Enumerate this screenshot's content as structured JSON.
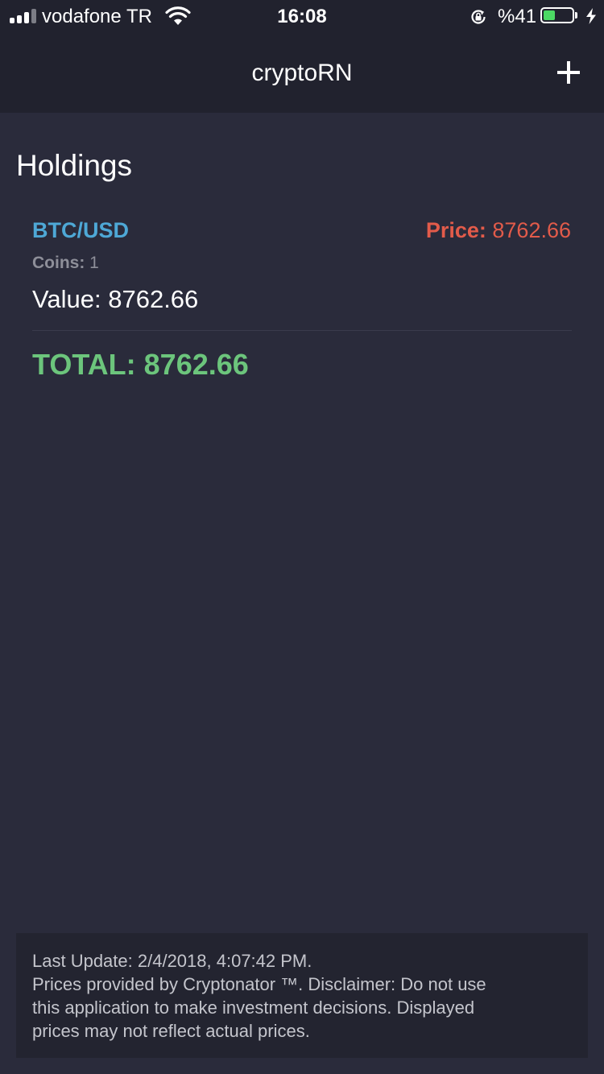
{
  "status_bar": {
    "carrier": "vodafone TR",
    "time": "16:08",
    "battery_percent": "%41",
    "battery_level": 0.41,
    "battery_color": "#4cd964"
  },
  "nav": {
    "title": "cryptoRN",
    "add_icon": "plus-icon"
  },
  "holdings": {
    "heading": "Holdings",
    "items": [
      {
        "pair": "BTC/USD",
        "price_label": "Price:",
        "price": "8762.66",
        "coins_label": "Coins:",
        "coins": "1",
        "value_label": "Value:",
        "value": "8762.66"
      }
    ],
    "total_label": "TOTAL:",
    "total": "8762.66"
  },
  "footer": {
    "last_update_label": "Last Update:",
    "last_update": "2/4/2018, 4:07:42 PM.",
    "disclaimer_lines": [
      "Prices provided by Cryptonator ™. Disclaimer: Do not use",
      "this application to make investment decisions. Displayed",
      "prices may not reflect actual prices."
    ]
  },
  "colors": {
    "background": "#2a2b3b",
    "header": "#21222e",
    "pair": "#4ea8d6",
    "price": "#e25b4a",
    "total": "#6cc57c",
    "muted": "#8e8f99"
  }
}
